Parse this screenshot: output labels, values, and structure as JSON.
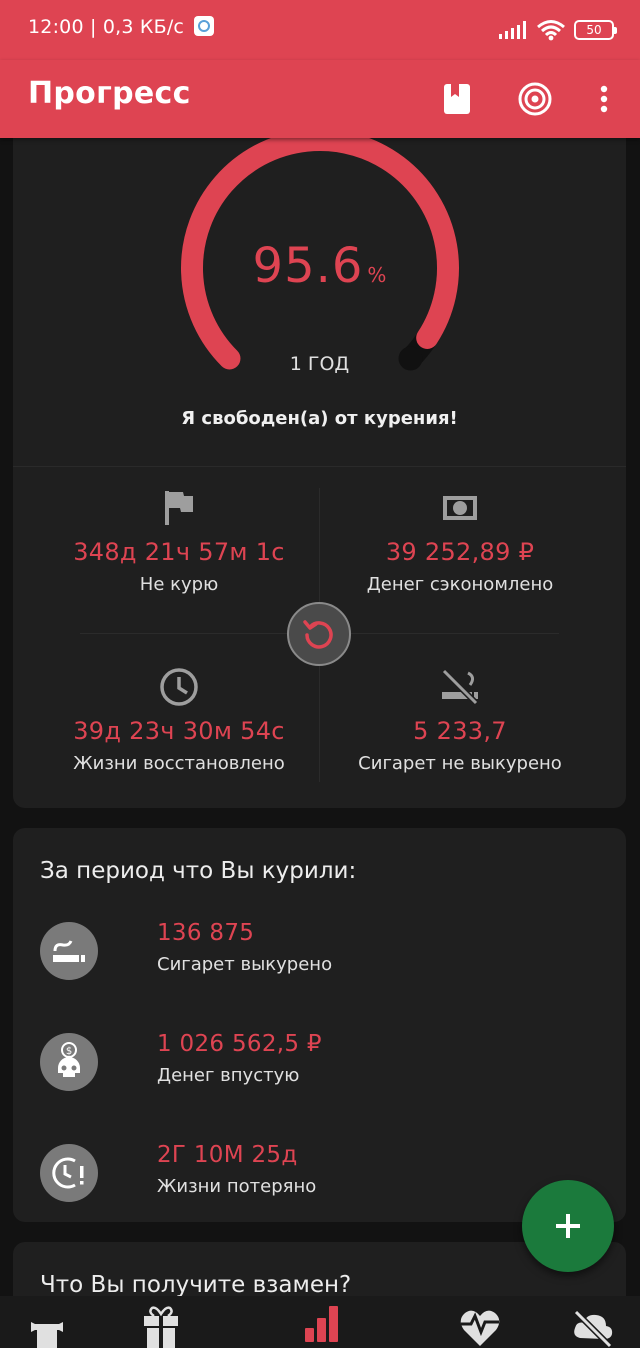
{
  "status_bar": {
    "time": "12:00 | 0,3 КБ/с",
    "battery": "50"
  },
  "appbar": {
    "title": "Прогресс"
  },
  "gauge": {
    "value": "95.6",
    "unit": "%",
    "percent": 95.6,
    "label": "1 ГОД"
  },
  "freedom_text": "Я свободен(а) от курения!",
  "stats": {
    "no_smoking": {
      "value": "348д 21ч 57м 1с",
      "label": "Не курю"
    },
    "money_saved": {
      "value": "39 252,89 ₽",
      "label": "Денег сэкономлено"
    },
    "life_regained": {
      "value": "39д 23ч 30м 54с",
      "label": "Жизни восстановлено"
    },
    "cigs_not_smoked": {
      "value": "5 233,7",
      "label": "Сигарет не выкурено"
    }
  },
  "period": {
    "title": "За период что Вы курили:",
    "items": [
      {
        "value": "136 875",
        "label": "Сигарет выкурено",
        "icon": "cigarette-icon"
      },
      {
        "value": "1 026 562,5 ₽",
        "label": "Денег впустую",
        "icon": "money-skull-icon"
      },
      {
        "value": "2Г 10М 25д",
        "label": "Жизни потеряно",
        "icon": "clock-alert-icon"
      }
    ]
  },
  "next_section": {
    "title": "Что Вы получите взамен?"
  },
  "colors": {
    "accent": "#de4452",
    "fab": "#1b7a3c",
    "card": "#1f1f1f",
    "background": "#121212"
  },
  "bottom_nav": {
    "items": [
      "trophy-icon",
      "gift-icon",
      "bar-chart-icon",
      "heart-pulse-icon",
      "no-smoking-cloud-icon"
    ],
    "active": "bar-chart-icon"
  }
}
